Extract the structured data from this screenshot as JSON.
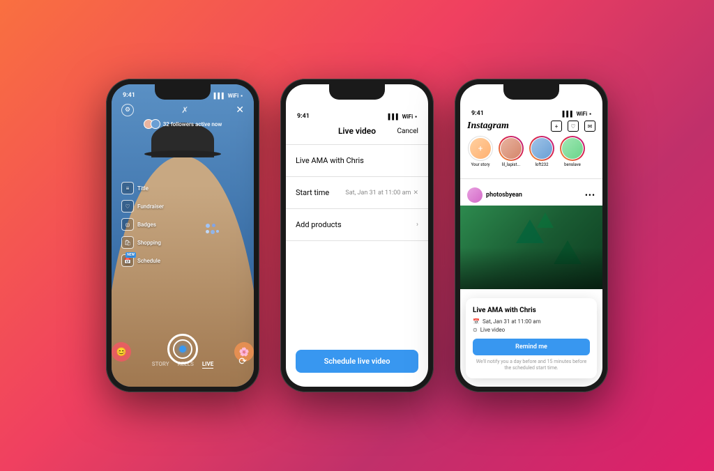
{
  "background": {
    "gradient": "linear-gradient(135deg, #f97040 0%, #f04060 40%, #c0306a 70%, #e0206a 100%)"
  },
  "phone1": {
    "status_time": "9:41",
    "signal": "▌▌▌",
    "wifi": "WiFi",
    "battery": "🔋",
    "followers_text": "32 followers active now",
    "menu_items": [
      {
        "icon": "≡",
        "label": "Title"
      },
      {
        "icon": "♡",
        "label": "Fundraiser"
      },
      {
        "icon": "◎",
        "label": "Badges"
      },
      {
        "icon": "🛍",
        "label": "Shopping"
      },
      {
        "icon": "📅",
        "label": "Schedule",
        "badge": "NEW"
      }
    ],
    "camera_modes": [
      "STORY",
      "REELS",
      "LIVE"
    ],
    "active_mode": "LIVE"
  },
  "phone2": {
    "status_time": "9:41",
    "signal": "▌▌▌",
    "wifi": "WiFi",
    "battery": "🔋",
    "header_title": "Live video",
    "cancel_label": "Cancel",
    "live_title": "Live AMA with Chris",
    "start_time_label": "Start time",
    "start_time_value": "Sat, Jan 31 at 11:00 am",
    "add_products_label": "Add products",
    "schedule_button": "Schedule live video"
  },
  "phone3": {
    "status_time": "9:41",
    "signal": "▌▌▌",
    "wifi": "WiFi",
    "battery": "🔋",
    "logo": "Instagram",
    "stories": [
      {
        "name": "Your story",
        "type": "your"
      },
      {
        "name": "lil_lapist...",
        "type": "active"
      },
      {
        "name": "loft232",
        "type": "active"
      },
      {
        "name": "benslave",
        "type": "active"
      }
    ],
    "post_user": "photosbyean",
    "notification": {
      "title": "Live AMA with Chris",
      "date": "Sat, Jan 31 at 11:00 am",
      "type": "Live video",
      "remind_button": "Remind me",
      "disclaimer": "We'll notify you a day before and 15 minutes before the scheduled start time."
    }
  }
}
